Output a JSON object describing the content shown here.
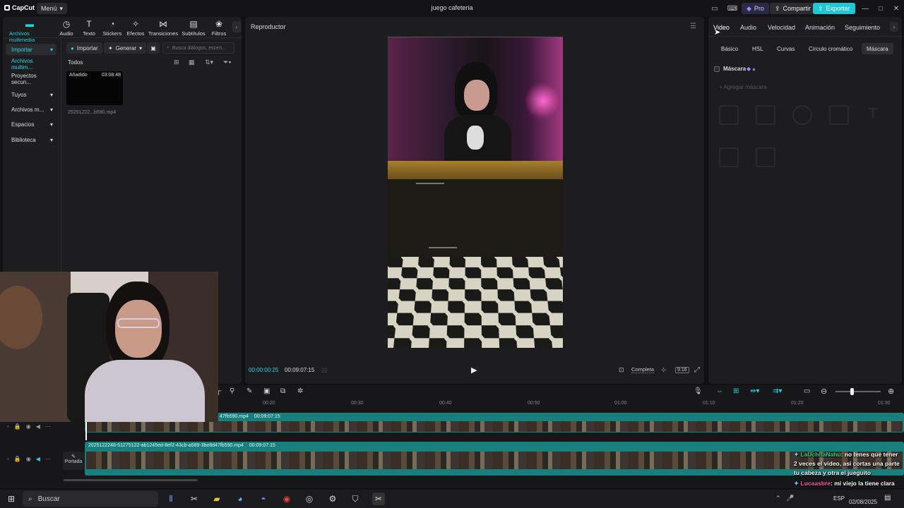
{
  "titlebar": {
    "logo": "CapCut",
    "menu": "Menú",
    "title": "juego cafeteria",
    "pro": "Pro",
    "share": "Compartir",
    "export": "Exportar"
  },
  "tool_tabs": [
    "Archivos multimedia",
    "Audio",
    "Texto",
    "Stickers",
    "Efectos",
    "Transiciones",
    "Subtítulos",
    "Filtros"
  ],
  "sidebar": {
    "items": [
      {
        "label": "Importar",
        "caret": "▾"
      },
      {
        "label": "Archivos multim..."
      },
      {
        "label": "Proyectos secun..."
      },
      {
        "label": "Tuyos",
        "caret": "▾"
      },
      {
        "label": "Archivos m...",
        "caret": "▾"
      },
      {
        "label": "Espacios",
        "caret": "▾"
      },
      {
        "label": "Biblioteca",
        "caret": "▾"
      }
    ]
  },
  "media": {
    "import": "Importar",
    "generate": "Generar",
    "search_placeholder": "Busca diálogos, escen...",
    "filter_label": "Todos",
    "clip": {
      "badge": "Añadido",
      "duration": "03:08:48",
      "name": "25251222...b590.mp4"
    }
  },
  "player": {
    "title": "Reproductor",
    "current": "00:00:00:25",
    "total": "00:09:07:15",
    "quality": "Completa",
    "ratio": "9:16"
  },
  "right_panel": {
    "tabs": [
      "Video",
      "Audio",
      "Velocidad",
      "Animación",
      "Seguimiento"
    ],
    "subtabs": [
      "Básico",
      "HSL",
      "Curvas",
      "Círculo cromático",
      "Máscara"
    ],
    "mask_title": "Máscara",
    "add_mask": "Agregar máscara"
  },
  "timeline": {
    "ruler": [
      "00:20",
      "00:30",
      "00:40",
      "00:50",
      "01:00",
      "01:10",
      "01:20",
      "01:30"
    ],
    "track1_label": "47fb590.mp4",
    "track1_time": "00:09:07:15",
    "track2_label": "2025122248-51275122-ab1245ed-8ef2-43cb-a689-3be8d47fb590.mp4",
    "track2_time": "00:09:07:15",
    "cover_label": "Portada"
  },
  "chat": [
    {
      "user": "LaUchitaNahu",
      "text": ": no tenes que tener 2 veces el video, así cortas una parte tu cabeza y otra el jueguito"
    },
    {
      "user": "Lucaasbre",
      "text": ": mi viejo la tiene clara con la edicion de videitos, el era camarografo"
    }
  ],
  "taskbar": {
    "search": "Buscar",
    "lang": "ESP",
    "date": "02/08/2025"
  }
}
